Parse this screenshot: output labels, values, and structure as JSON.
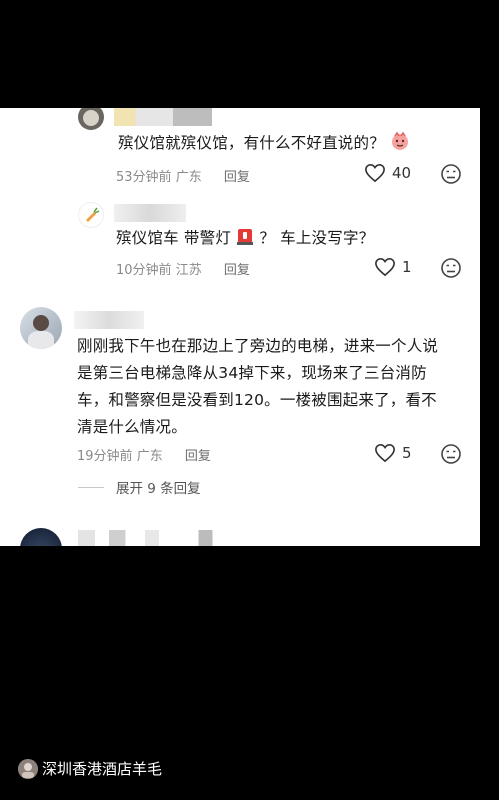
{
  "comments": [
    {
      "text": "殡仪馆就殡仪馆，有什么不好直说的？",
      "time": "53分钟前",
      "location": "广东",
      "reply_label": "回复",
      "likes": "40"
    },
    {
      "text_part1": "殡仪馆车 带警灯",
      "text_part2": "？ 车上没写字？",
      "time": "10分钟前",
      "location": "江苏",
      "reply_label": "回复",
      "likes": "1"
    },
    {
      "text_line1": "刚刚我下午也在那边上了旁边的电梯，进来一个人说",
      "text_line2": "是第三台电梯急降从34掉下来，现场来了三台消防",
      "text_line3": "车，和警察但是没看到120。一楼被围起来了，看不",
      "text_line4": "清是什么情况。",
      "time": "19分钟前",
      "location": "广东",
      "reply_label": "回复",
      "likes": "5",
      "expand_label": "展开 9 条回复"
    }
  ],
  "watermark": {
    "text": "深圳香港酒店羊毛"
  }
}
